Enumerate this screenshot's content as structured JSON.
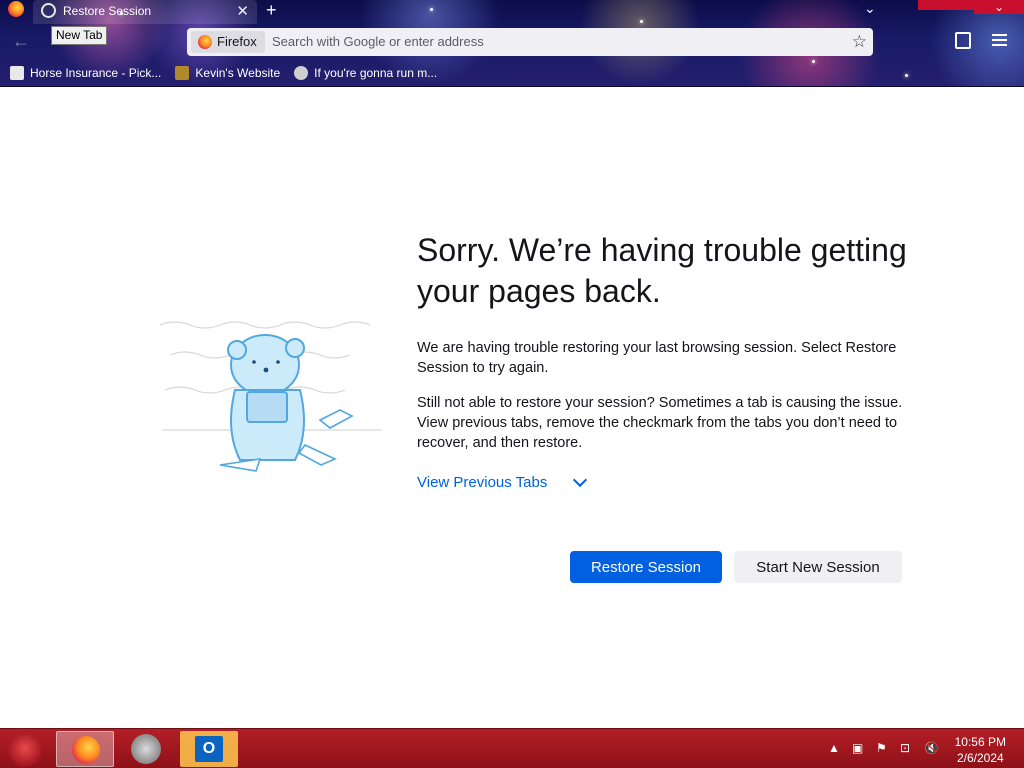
{
  "browser": {
    "tab_title": "Restore Session",
    "tab_close_glyph": "✕",
    "new_tab_glyph": "+",
    "tooltip": "New Tab",
    "identity_label": "Firefox",
    "url_placeholder": "Search with Google or enter address",
    "bookmarks": [
      {
        "label": "Horse Insurance - Pick..."
      },
      {
        "label": "Kevin's Website"
      },
      {
        "label": "If you're gonna run m..."
      }
    ]
  },
  "page": {
    "heading": "Sorry. We’re having trouble getting your pages back.",
    "para1": "We are having trouble restoring your last browsing session. Select Restore Session to try again.",
    "para2": "Still not able to restore your session? Sometimes a tab is causing the issue. View previous tabs, remove the checkmark from the tabs you don’t need to recover, and then restore.",
    "view_previous_tabs": "View Previous Tabs",
    "restore_button": "Restore Session",
    "new_session_button": "Start New Session"
  },
  "taskbar": {
    "time": "10:56 PM",
    "date": "2/6/2024",
    "apps": [
      "firefox",
      "safari",
      "outlook"
    ]
  },
  "colors": {
    "accent": "#0060df",
    "taskbar": "#a8171f"
  }
}
